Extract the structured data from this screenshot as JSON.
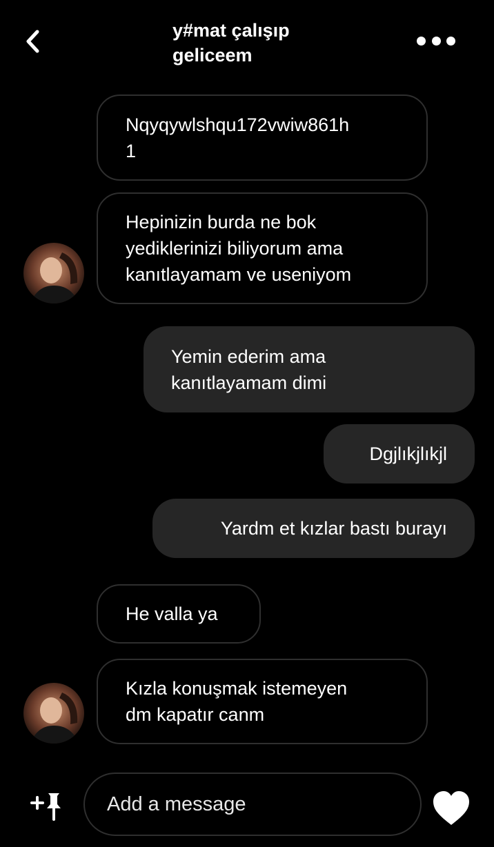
{
  "header": {
    "title": "y#mat çalışıp\ngeliceem",
    "back_icon": "chevron-left-icon",
    "more_icon": "more-horizontal-icon"
  },
  "messages": [
    {
      "side": "incoming",
      "text": "Nqyqywlshqu172vwiw861h\n1"
    },
    {
      "side": "incoming",
      "text": "Hepinizin burda ne bok\nyediklerinizi biliyorum ama\nkanıtlayamam ve useniyom"
    },
    {
      "side": "outgoing",
      "text": "Yemin ederim ama\nkanıtlayamam dimi"
    },
    {
      "side": "outgoing",
      "text": "Dgjlıkjlıkjl"
    },
    {
      "side": "outgoing",
      "text": "Yardm et kızlar bastı burayı"
    },
    {
      "side": "incoming",
      "text": "He valla ya"
    },
    {
      "side": "incoming",
      "text": "Kızla konuşmak istemeyen\ndm kapatır canm"
    }
  ],
  "composer": {
    "placeholder": "Add a message",
    "attach_icon": "plus-pin-icon",
    "like_icon": "heart-icon"
  },
  "colors": {
    "background": "#000000",
    "outgoing_bubble": "#262626",
    "incoming_border": "#2f2f2f",
    "text": "#ffffff"
  }
}
